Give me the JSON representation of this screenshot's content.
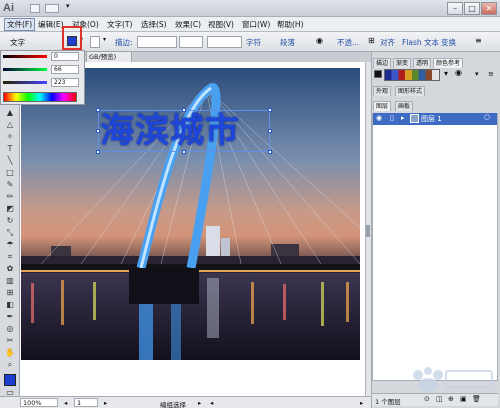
{
  "app": {
    "logo_text": "Ai"
  },
  "menubar": {
    "items": [
      "文件(F)",
      "编辑(E)",
      "对象(O)",
      "文字(T)",
      "选择(S)",
      "效果(C)",
      "视图(V)",
      "窗口(W)",
      "帮助(H)"
    ]
  },
  "controlbar": {
    "mode_label": "文字",
    "stroke_label": "描边:",
    "char_label": "字符",
    "para_label": "段落",
    "opacity_label": "不透...",
    "align_label": "对齐",
    "flash_label": "Flash 文本",
    "transform_label": "变换"
  },
  "color_panel": {
    "values": [
      "0",
      "66",
      "223"
    ]
  },
  "document": {
    "tab_label": "GB/预览)",
    "headline": "海滨城市"
  },
  "right_panels": {
    "top_tabs": [
      "描边",
      "渐变",
      "透明",
      "颜色参考"
    ],
    "mid_tabs": [
      "外观",
      "图形样式"
    ],
    "layer_tabs": [
      "图层",
      "画板"
    ],
    "layer_name": "图层 1",
    "footer_count": "1 个图层"
  },
  "statusbar": {
    "zoom": "100%",
    "page": "1",
    "tool_status": "编组选择"
  },
  "colors": {
    "headline": "#1e46d8",
    "highlight": "#e0322a",
    "selection": "#3e6cc4"
  }
}
